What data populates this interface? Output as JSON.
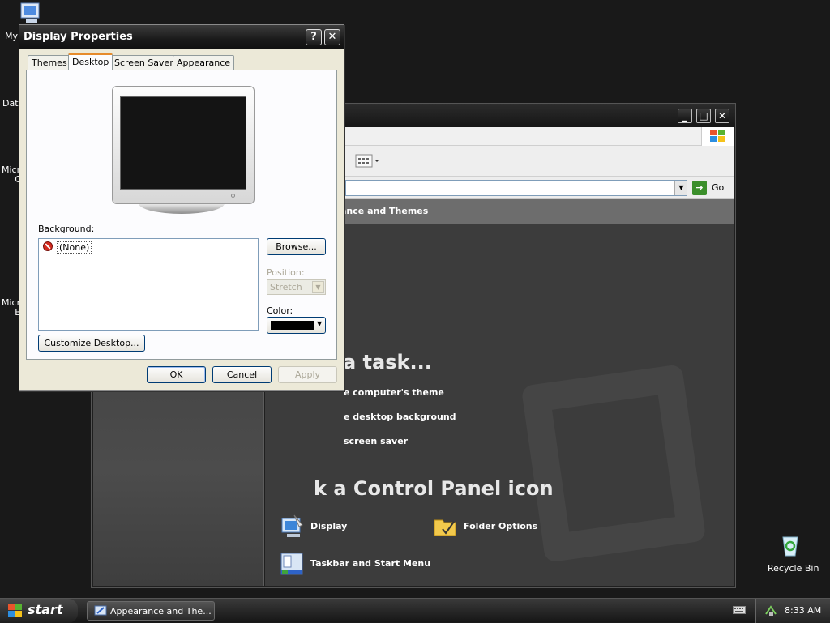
{
  "desktop": {
    "icons": [
      {
        "name": "my-computer-icon",
        "label": "My"
      },
      {
        "name": "data-icon",
        "label": "Dat"
      },
      {
        "name": "microsoft-icon-1",
        "label": "Micro\nC"
      },
      {
        "name": "microsoft-icon-2",
        "label": "Micro\nB"
      },
      {
        "name": "recycle-bin-icon",
        "label": "Recycle Bin"
      }
    ]
  },
  "control_panel": {
    "address_go_label": "Go",
    "header_title": "ance and Themes",
    "pick_task_heading": "a task...",
    "tasks": [
      "e computer's theme",
      "e desktop background",
      "screen saver"
    ],
    "pick_icon_heading": "k a Control Panel icon",
    "icons": [
      {
        "label": "Display",
        "icon": "display-icon"
      },
      {
        "label": "Folder Options",
        "icon": "folder-options-icon"
      },
      {
        "label": "Taskbar and Start Menu",
        "icon": "taskbar-start-menu-icon"
      }
    ]
  },
  "dialog": {
    "title": "Display Properties",
    "help_button": "?",
    "close_button": "✕",
    "tabs": [
      "Themes",
      "Desktop",
      "Screen Saver",
      "Appearance"
    ],
    "active_tab": "Desktop",
    "background_label": "Background:",
    "background_items": [
      "(None)"
    ],
    "browse_button": "Browse...",
    "position_label": "Position:",
    "position_value": "Stretch",
    "color_label": "Color:",
    "color_value": "#000000",
    "customize_button": "Customize Desktop...",
    "ok_button": "OK",
    "cancel_button": "Cancel",
    "apply_button": "Apply"
  },
  "taskbar": {
    "start_label": "start",
    "task_button": "Appearance and The...",
    "clock": "8:33 AM"
  }
}
